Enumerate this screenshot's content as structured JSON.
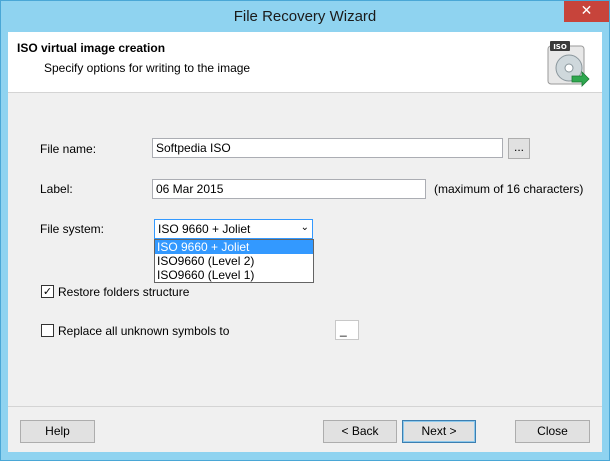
{
  "window": {
    "title": "File Recovery Wizard",
    "close_glyph": "✕"
  },
  "header": {
    "title": "ISO virtual image creation",
    "subtitle": "Specify options for writing to the image",
    "icon_label": "ISO",
    "icon": "iso-disc-icon"
  },
  "form": {
    "file_name_label": "File name:",
    "file_name_value": "Softpedia ISO",
    "browse_label": "...",
    "label_label": "Label:",
    "label_value": "06 Mar 2015",
    "label_hint": "(maximum of 16 characters)",
    "file_system_label": "File system:",
    "file_system_value": "ISO 9660 + Joliet",
    "file_system_options": [
      "ISO 9660 + Joliet",
      "ISO9660 (Level 2)",
      "ISO9660 (Level 1)"
    ],
    "restore_folders_label": "Restore folders structure",
    "restore_folders_checked": true,
    "replace_symbols_label": "Replace all unknown symbols to",
    "replace_symbols_checked": false,
    "replace_symbols_value": "_"
  },
  "buttons": {
    "help": "Help",
    "back": "< Back",
    "next": "Next >",
    "close": "Close"
  },
  "colors": {
    "accent": "#3399ff",
    "titlebar": "#8fd3f0",
    "close": "#c7443b"
  }
}
